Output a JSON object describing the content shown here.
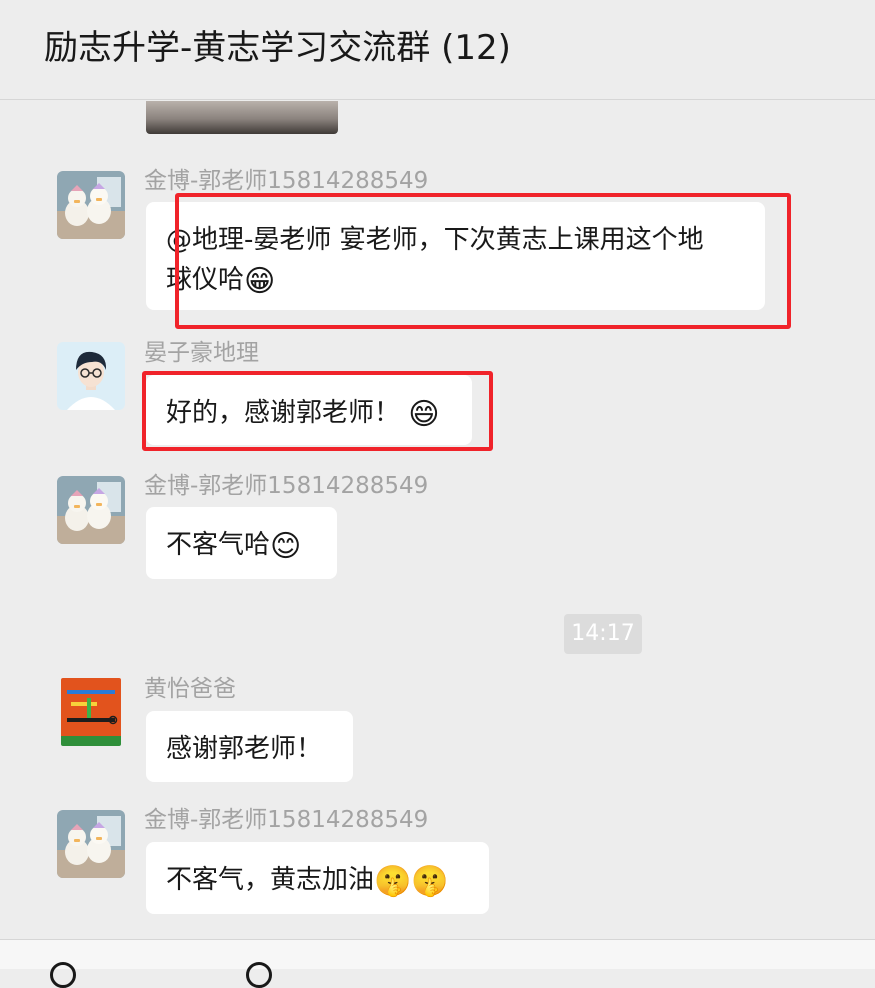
{
  "header": {
    "title": "励志升学-黄志学习交流群 (12)"
  },
  "messages": [
    {
      "sender": "金博-郭老师15814288549",
      "text_line1": "@地理-晏老师 宴老师，下次黄志上课用这个地",
      "text_line2": "球仪哈",
      "emoji": "😁"
    },
    {
      "sender": "晏子豪地理",
      "text": "好的，感谢郭老师！",
      "emoji": "😄"
    },
    {
      "sender": "金博-郭老师15814288549",
      "text": "不客气哈",
      "emoji": "😊"
    },
    {
      "sender": "黄怡爸爸",
      "text": "感谢郭老师！"
    },
    {
      "sender": "金博-郭老师15814288549",
      "text": "不客气，黄志加油",
      "emoji": "🤫🤫"
    }
  ],
  "timestamp": "14:17",
  "colors": {
    "background": "#ededed",
    "bubble": "#ffffff",
    "highlight": "#f0232a",
    "sender": "#a3a3a3"
  },
  "icons": [
    "voice-icon",
    "emoji-icon",
    "plus-icon"
  ]
}
